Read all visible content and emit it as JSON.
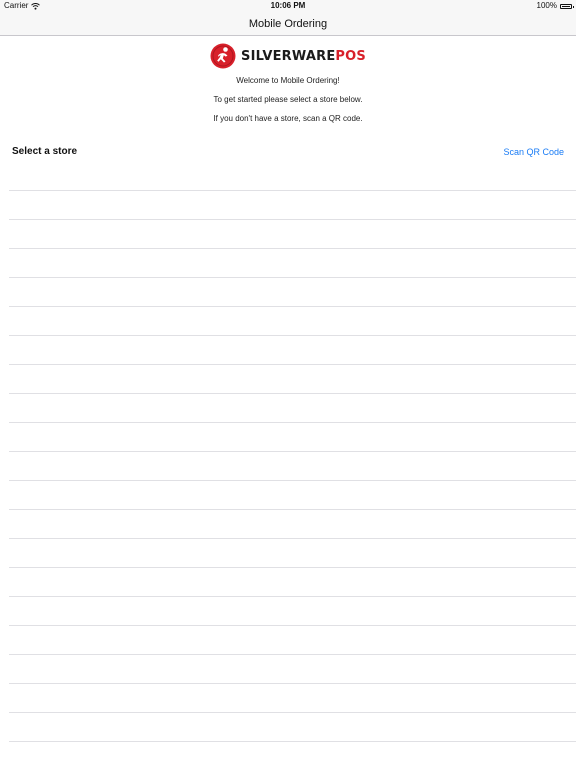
{
  "status_bar": {
    "carrier": "Carrier",
    "time": "10:06 PM",
    "battery": "100%",
    "battery_level": 1.0
  },
  "nav": {
    "title": "Mobile Ordering"
  },
  "brand": {
    "name_part1": "SILVERWARE",
    "name_part2": "POS",
    "accent_color": "#d8202a"
  },
  "intro": {
    "line1": "Welcome to Mobile Ordering!",
    "line2": "To get started please select a store below.",
    "line3": "If you don't have a store, scan a QR code."
  },
  "store_section": {
    "title": "Select a store",
    "scan_label": "Scan QR Code",
    "link_color": "#1a7cf5"
  },
  "icons": {
    "wifi": "wifi-icon",
    "battery": "battery-icon",
    "logo": "silverware-logo-icon"
  }
}
